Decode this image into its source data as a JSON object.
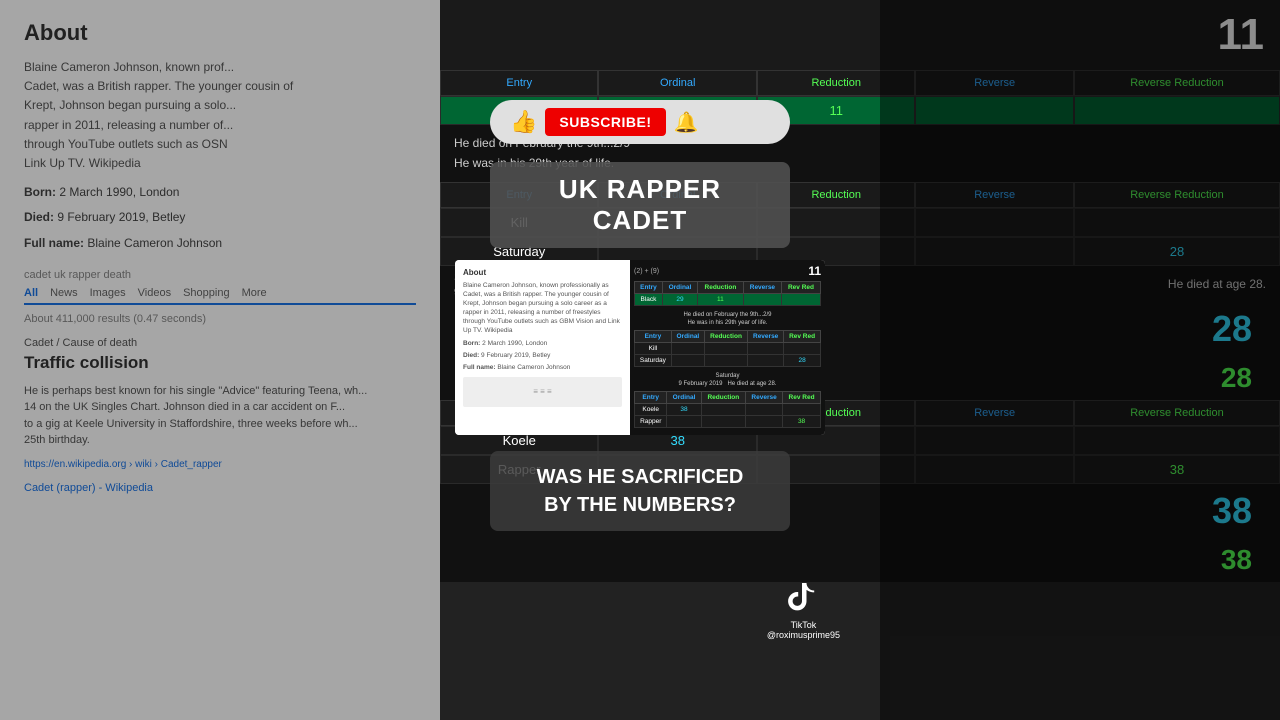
{
  "left": {
    "about_title": "About",
    "about_text": "Blaine Cameron Johnson, known prof... Cadet, was a British rapper. The youn... Krept, Johnson began pursuing a sol... rapper in 2011, releasing a number o... through YouTube outlets such as OS... Link Up TV. Wikipedia",
    "born_label": "Born:",
    "born_value": "2 March 1990, London",
    "died_label": "Died:",
    "died_value": "9 February 2019, Betley",
    "fullname_label": "Full name:",
    "fullname_value": "Blaine Cameron Johnson",
    "search_meta": "cadet uk rapper death",
    "tab_all": "All",
    "tab_news": "News",
    "tab_images": "Images",
    "tab_videos": "Videos",
    "tab_shopping": "Shopping",
    "tab_more": "More",
    "result_count": "About 411,000 results (0.47 seconds)",
    "breadcrumb": "Cadet / Cause of death",
    "traffic_title": "Traffic collision",
    "traffic_text": "He is perhaps best known for his single 'Advice' featuring Teena, wh... 14 on the UK Singles Chart. Johnson died in a car accident on F... to a gig at Keele University in Staffordshire, three weeks before wh... 25th birthday.",
    "wiki_url": "https://en.wikipedia.org › wiki › Cadet_rapper",
    "wiki_link": "Cadet (rapper) - Wikipedia"
  },
  "right": {
    "top_number": "11",
    "table1": {
      "headers": [
        "Entry",
        "Ordinal",
        "Reduction",
        "Reverse",
        "Reverse Reduction"
      ],
      "row": [
        "Black",
        "29",
        "11",
        "",
        ""
      ],
      "highlight": "green"
    },
    "text1": "He died on February the 9th...2/9\nHe was in his 29th year of life.",
    "table2": {
      "headers": [
        "Entry",
        "Ordinal",
        "Reduction",
        "Reverse",
        "Reverse Reduction"
      ],
      "rows": [
        [
          "Kill",
          "",
          "",
          "",
          ""
        ],
        [
          "Saturday",
          "",
          "",
          "",
          "28"
        ]
      ]
    },
    "saturday_label": "Saturday",
    "saturday_date": "9 February 2019",
    "text2": "He died at age 28.",
    "big_number1": "28",
    "big_number2": "28",
    "table3": {
      "headers": [
        "Entry",
        "Ordinal",
        "Reduction",
        "Reverse",
        "Reverse Reduction"
      ],
      "rows": [
        [
          "Koele",
          "38",
          "",
          "",
          ""
        ],
        [
          "Rapper",
          "",
          "",
          "",
          "38"
        ]
      ]
    },
    "big_number3": "38",
    "big_number4": "38"
  },
  "overlay": {
    "subscribe_label": "SUBSCRIBE!",
    "title": "UK RAPPER CADET",
    "bottom_text": "WAS HE SACRIFICED\nBY THE NUMBERS?",
    "tiktok_handle": "@roximusprime95"
  },
  "inner": {
    "about": "About",
    "about_text": "Blaine Cameron Johnson, known professionally as Cadet, was a British rapper. The younger cousin of Krept, Johnson began pursuing a solo career as a rapper in 2011, releasing a number of freestyles through YouTube outlets such as GBM Vision and Link Up TV. Wikipedia",
    "born": "Born: 2 March 1990, London",
    "died": "Died: 9 February 2019, Betley",
    "fullname": "Full name: Blaine Cameron Johnson",
    "eq": "(2) + (9)",
    "eq_result": "11",
    "t1_e": "Entry",
    "t1_o": "Ordinal",
    "t1_r": "Reduction",
    "t1_rv": "Reverse",
    "t1_rr": "Reverse Reduction",
    "t1_row_e": "Black",
    "t1_row_o": "29",
    "t1_row_r": "11",
    "text_a": "He died on February the 9th...2/9",
    "text_b": "He was in his 29th year of life.",
    "t2_e": "Entry",
    "t2_o": "Ordinal",
    "t2_r": "Reduction",
    "t2_rv": "Reverse",
    "t2_rr": "Reverse Reduction",
    "t2_r1_e": "Kill",
    "t2_r2_e": "Saturday",
    "t2_r2_rr": "28",
    "saturday": "Saturday",
    "sat_date": "9 February 2019",
    "text_c": "He died at age 28.",
    "t3_e": "Entry",
    "t3_o": "Ordinal",
    "t3_r": "Reduction",
    "t3_rv": "Reverse",
    "t3_rr": "Reverse Reduction",
    "t3_r1_e": "Koele",
    "t3_r1_o": "38",
    "t3_r2_e": "Rapper",
    "t3_r2_rr": "38"
  }
}
